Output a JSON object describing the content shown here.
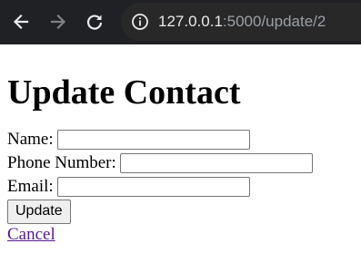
{
  "browser": {
    "url_host": "127.0.0.1",
    "url_path": ":5000/update/2",
    "back_icon": "arrow-left-icon",
    "forward_icon": "arrow-right-icon",
    "reload_icon": "reload-icon",
    "site_info_icon": "info-icon"
  },
  "page": {
    "title": "Update Contact",
    "form": {
      "name_label": "Name:",
      "name_value": "",
      "phone_label": "Phone Number:",
      "phone_value": "",
      "email_label": "Email:",
      "email_value": "",
      "submit_label": "Update"
    },
    "cancel_link": "Cancel"
  },
  "colors": {
    "toolbar_bg": "#202124",
    "omnibox_bg": "#282828",
    "visited_link": "#551a8b"
  }
}
